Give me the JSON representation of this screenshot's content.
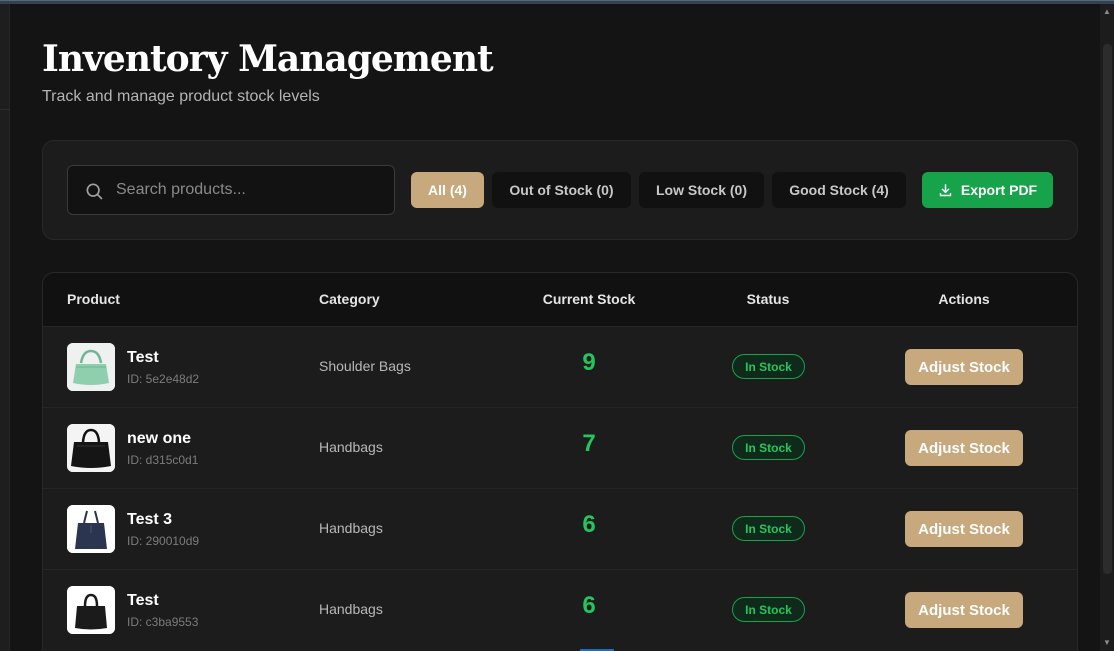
{
  "page": {
    "title": "Inventory Management",
    "subtitle": "Track and manage product stock levels"
  },
  "search": {
    "placeholder": "Search products...",
    "value": ""
  },
  "filters": [
    {
      "label": "All (4)",
      "active": true
    },
    {
      "label": "Out of Stock (0)",
      "active": false
    },
    {
      "label": "Low Stock (0)",
      "active": false
    },
    {
      "label": "Good Stock (4)",
      "active": false
    }
  ],
  "export_label": "Export PDF",
  "table": {
    "headers": [
      "Product",
      "Category",
      "Current Stock",
      "Status",
      "Actions"
    ],
    "rows": [
      {
        "name": "Test",
        "id": "ID: 5e2e48d2",
        "category": "Shoulder Bags",
        "stock": "9",
        "status": "In Stock",
        "action": "Adjust Stock",
        "image": "green-shoulder-bag"
      },
      {
        "name": "new one",
        "id": "ID: d315c0d1",
        "category": "Handbags",
        "stock": "7",
        "status": "In Stock",
        "action": "Adjust Stock",
        "image": "black-handbag"
      },
      {
        "name": "Test 3",
        "id": "ID: 290010d9",
        "category": "Handbags",
        "stock": "6",
        "status": "In Stock",
        "action": "Adjust Stock",
        "image": "navy-tote-bag"
      },
      {
        "name": "Test",
        "id": "ID: c3ba9553",
        "category": "Handbags",
        "stock": "6",
        "status": "In Stock",
        "action": "Adjust Stock",
        "image": "black-satchel-bag"
      }
    ]
  },
  "colors": {
    "accent": "#c8a97e",
    "success": "#16a34a",
    "stock_text": "#22c55e",
    "background": "#141414",
    "panel": "#1c1c1c"
  }
}
